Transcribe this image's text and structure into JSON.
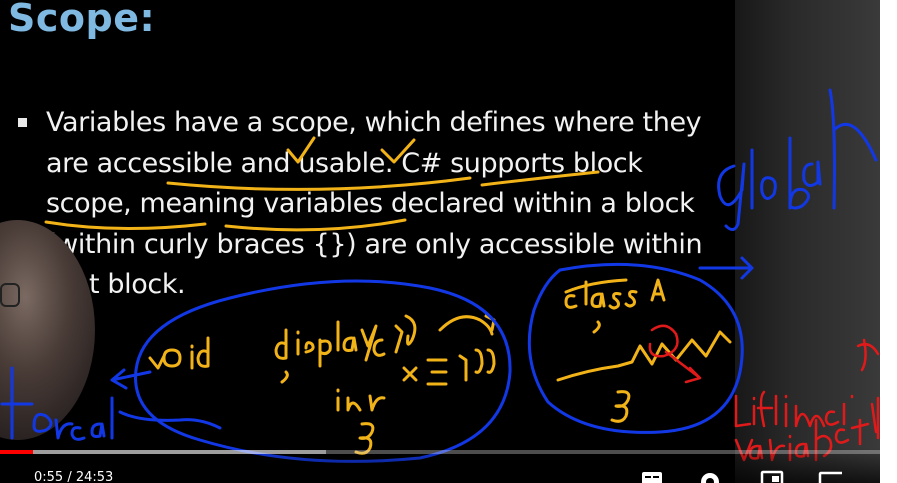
{
  "slide": {
    "title": "Scope:",
    "bullet_text": "Variables have a scope, which defines where they are accessible and usable. C# supports block scope, meaning variables declared within a block (within curly braces {}) are only accessible within that block."
  },
  "player": {
    "time_display": "0:55 / 24:53",
    "progress_fraction": 0.037,
    "buffer_fraction": 0.37,
    "icons": [
      "subtitles-icon",
      "settings-gear-icon",
      "miniplayer-icon",
      "theater-mode-icon"
    ]
  },
  "colors": {
    "title": "#7fb8e0",
    "ink_yellow": "#f2b318",
    "ink_blue": "#1238e6",
    "ink_red": "#e01a1a",
    "progress": "#ff0000"
  }
}
